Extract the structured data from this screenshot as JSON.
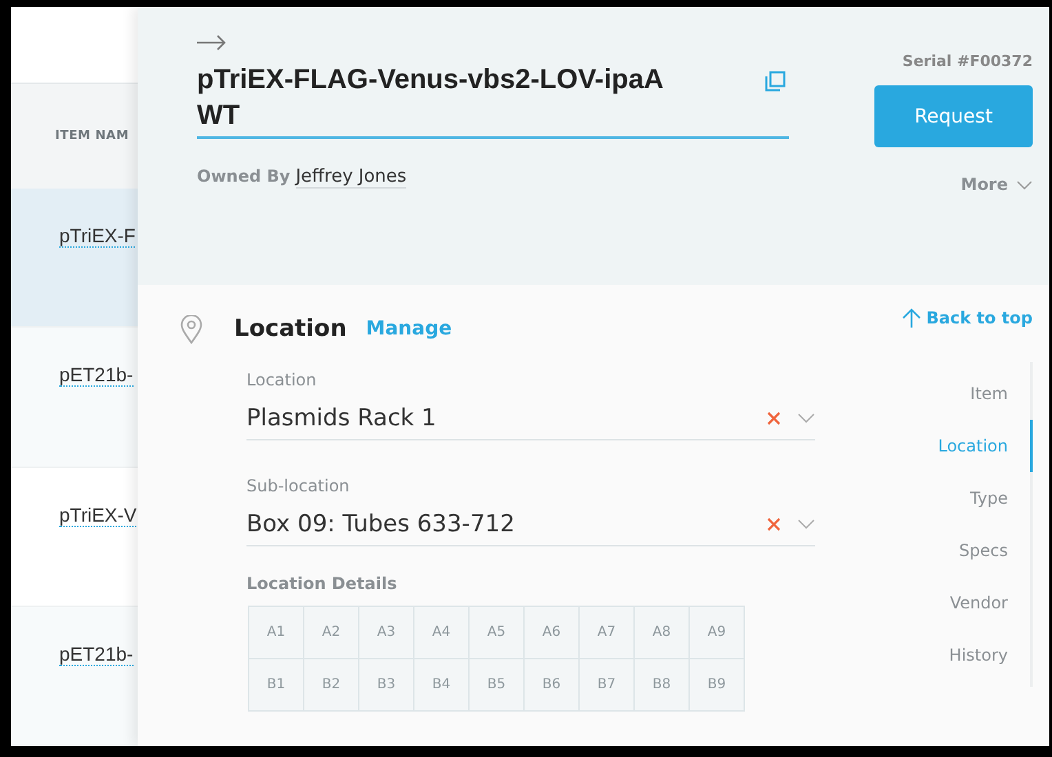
{
  "list": {
    "column_header": "ITEM NAM",
    "rows": [
      {
        "name": "pTriEX-F",
        "selected": true
      },
      {
        "name": "pET21b-",
        "selected": false
      },
      {
        "name": "pTriEX-V",
        "selected": false
      },
      {
        "name": "pET21b-",
        "selected": false
      }
    ]
  },
  "drawer": {
    "title": "pTriEX-FLAG-Venus-vbs2-LOV-ipaA WT",
    "owned_by_label": "Owned By",
    "owner": "Jeffrey Jones",
    "serial": "Serial #F00372",
    "request_button": "Request",
    "more": "More",
    "section": {
      "title": "Location",
      "action": "Manage",
      "back_to_top": "Back to top",
      "fields": [
        {
          "label": "Location",
          "value": "Plasmids Rack 1"
        },
        {
          "label": "Sub-location",
          "value": "Box 09: Tubes 633-712"
        }
      ],
      "details_label": "Location Details",
      "grid": [
        [
          "A1",
          "A2",
          "A3",
          "A4",
          "A5",
          "A6",
          "A7",
          "A8",
          "A9"
        ],
        [
          "B1",
          "B2",
          "B3",
          "B4",
          "B5",
          "B6",
          "B7",
          "B8",
          "B9"
        ]
      ]
    },
    "nav": [
      {
        "label": "Item",
        "selected": false
      },
      {
        "label": "Location",
        "selected": true
      },
      {
        "label": "Type",
        "selected": false
      },
      {
        "label": "Specs",
        "selected": false
      },
      {
        "label": "Vendor",
        "selected": false
      },
      {
        "label": "History",
        "selected": false
      }
    ]
  }
}
